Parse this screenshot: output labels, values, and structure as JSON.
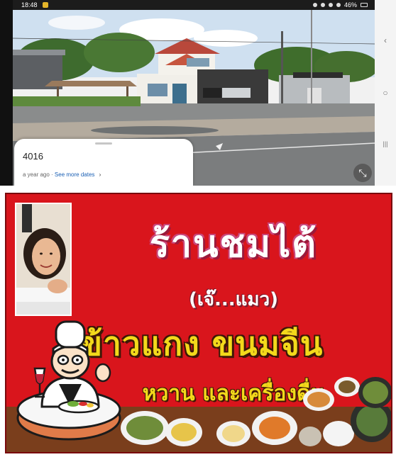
{
  "status_bar": {
    "time": "18:48",
    "battery": "46%"
  },
  "street_view": {
    "title": "4016",
    "age": "a year ago",
    "separator": " · ",
    "see_more": "See more dates",
    "chevron": "›"
  },
  "nav": {
    "back_icon": "‹",
    "home_icon": "○",
    "recents_icon": "|||"
  },
  "banner": {
    "shop_name": "ร้านชมไต้",
    "owner_name": "(เจ๊...แมว)",
    "menu_line1": "ข้าวแกง  ขนมจีน",
    "menu_line2": "หวาน  และเครื่องดื่ม"
  },
  "colors": {
    "banner_red": "#d9151c",
    "menu_yellow": "#f3d91b",
    "link_blue": "#1a5fb4"
  }
}
